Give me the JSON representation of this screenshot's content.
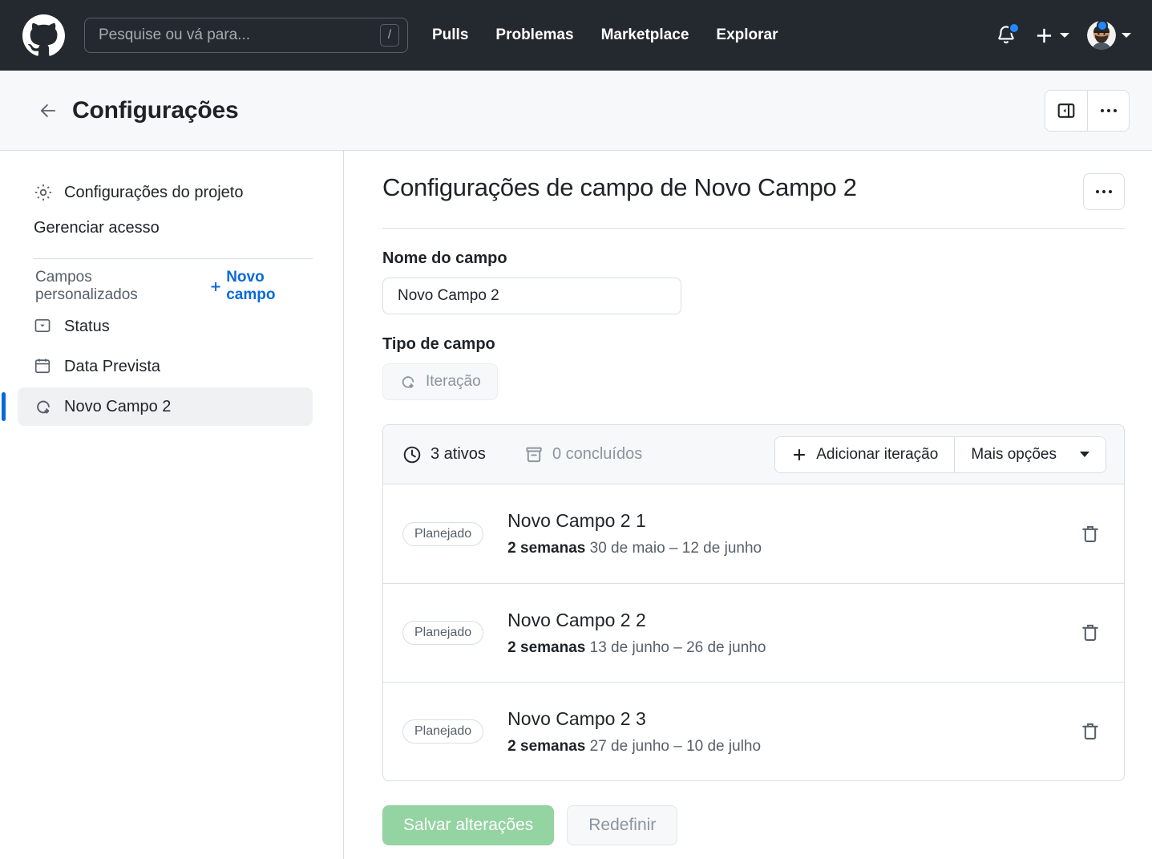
{
  "topnav": {
    "logo_icon": "github-mark-icon",
    "search": {
      "placeholder": "Pesquise ou vá para...",
      "shortcut_badge": "/",
      "icon": "search-input"
    },
    "links": [
      {
        "label": "Pulls"
      },
      {
        "label": "Problemas"
      },
      {
        "label": "Marketplace"
      },
      {
        "label": "Explorar"
      }
    ],
    "notifications_icon": "bell-icon",
    "has_notification_dot": true,
    "create_new_icon": "plus-icon",
    "avatar_icon": "avatar",
    "background_color": "#24292F"
  },
  "page_header": {
    "back_icon": "arrow-left-icon",
    "title": "Configurações",
    "actions": [
      {
        "icon": "sidebar-collapse-icon"
      },
      {
        "icon": "kebab-menu-icon"
      }
    ]
  },
  "sidebar": {
    "links": [
      {
        "label": "Configurações do projeto",
        "icon": "gear-icon"
      },
      {
        "label": "Gerenciar acesso",
        "icon": null
      }
    ],
    "section": {
      "label": "Campos personalizados",
      "new_field_label": "Novo campo",
      "new_field_icon": "plus-icon",
      "link_color": "#0969DA"
    },
    "fields": [
      {
        "label": "Status",
        "icon": "single-select-icon",
        "selected": false
      },
      {
        "label": "Data Prevista",
        "icon": "calendar-icon",
        "selected": false
      },
      {
        "label": "Novo Campo 2",
        "icon": "iteration-icon",
        "selected": true
      }
    ],
    "selected_indicator_color": "#0969DA"
  },
  "main": {
    "title": "Configurações de campo de Novo Campo 2",
    "kebab_icon": "kebab-menu-icon",
    "field_name": {
      "label": "Nome do campo",
      "value": "Novo Campo 2"
    },
    "field_type": {
      "label": "Tipo de campo",
      "value": "Iteração",
      "icon": "iteration-icon",
      "disabled": true
    },
    "panel": {
      "active_count_label": "3 ativos",
      "active_icon": "clock-icon",
      "completed_count_label": "0 concluídos",
      "completed_icon": "archive-icon",
      "add_iteration_label": "Adicionar iteração",
      "add_iteration_icon": "plus-icon",
      "more_options_label": "Mais opções",
      "more_options_icon": "chevron-down-icon",
      "iterations": [
        {
          "status_badge": "Planejado",
          "name": "Novo Campo 2 1",
          "duration": "2 semanas",
          "date_range": "30 de maio – 12 de junho",
          "delete_icon": "trash-icon"
        },
        {
          "status_badge": "Planejado",
          "name": "Novo Campo 2 2",
          "duration": "2 semanas",
          "date_range": "13 de junho – 26 de junho",
          "delete_icon": "trash-icon"
        },
        {
          "status_badge": "Planejado",
          "name": "Novo Campo 2 3",
          "duration": "2 semanas",
          "date_range": "27 de junho – 10 de julho",
          "delete_icon": "trash-icon"
        }
      ]
    },
    "footer": {
      "save_label": "Salvar alterações",
      "save_color": "#94D3A2",
      "reset_label": "Redefinir"
    }
  }
}
